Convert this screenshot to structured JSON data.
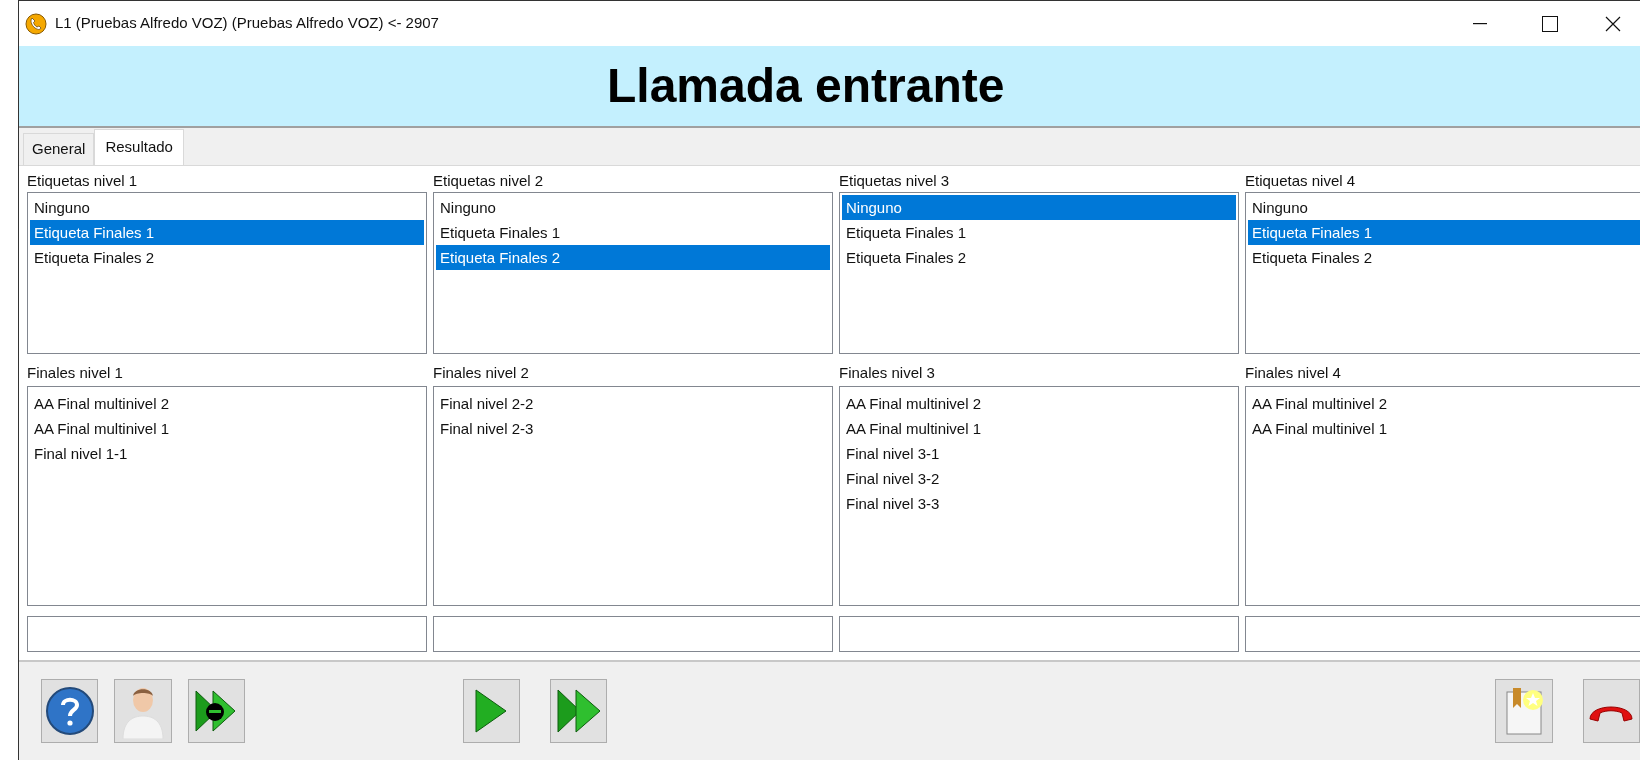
{
  "window": {
    "title": "L1 (Pruebas Alfredo VOZ) (Pruebas Alfredo VOZ) <- 2907"
  },
  "header": {
    "title": "Llamada entrante"
  },
  "tabs": [
    {
      "label": "General",
      "selected": false
    },
    {
      "label": "Resultado",
      "selected": true
    }
  ],
  "columns": [
    {
      "tags_label": "Etiquetas nivel 1",
      "tags": [
        {
          "text": "Ninguno",
          "selected": false
        },
        {
          "text": "Etiqueta Finales 1",
          "selected": true
        },
        {
          "text": "Etiqueta Finales 2",
          "selected": false
        }
      ],
      "finals_label": "Finales nivel 1",
      "finals": [
        "AA Final multinivel 2",
        "AA Final multinivel 1",
        "Final nivel 1-1"
      ]
    },
    {
      "tags_label": "Etiquetas nivel 2",
      "tags": [
        {
          "text": "Ninguno",
          "selected": false
        },
        {
          "text": "Etiqueta Finales 1",
          "selected": false
        },
        {
          "text": "Etiqueta Finales 2",
          "selected": true
        }
      ],
      "finals_label": "Finales nivel 2",
      "finals": [
        "Final nivel 2-2",
        "Final nivel 2-3"
      ]
    },
    {
      "tags_label": "Etiquetas nivel 3",
      "tags": [
        {
          "text": "Ninguno",
          "selected": true
        },
        {
          "text": "Etiqueta Finales 1",
          "selected": false
        },
        {
          "text": "Etiqueta Finales 2",
          "selected": false
        }
      ],
      "finals_label": "Finales nivel 3",
      "finals": [
        "AA Final multinivel 2",
        "AA Final multinivel 1",
        "Final nivel 3-1",
        "Final nivel 3-2",
        "Final nivel 3-3"
      ]
    },
    {
      "tags_label": "Etiquetas nivel 4",
      "tags": [
        {
          "text": "Ninguno",
          "selected": false
        },
        {
          "text": "Etiqueta Finales 1",
          "selected": true
        },
        {
          "text": "Etiqueta Finales 2",
          "selected": false
        }
      ],
      "finals_label": "Finales nivel 4",
      "finals": [
        "AA Final multinivel 2",
        "AA Final multinivel 1"
      ]
    }
  ]
}
